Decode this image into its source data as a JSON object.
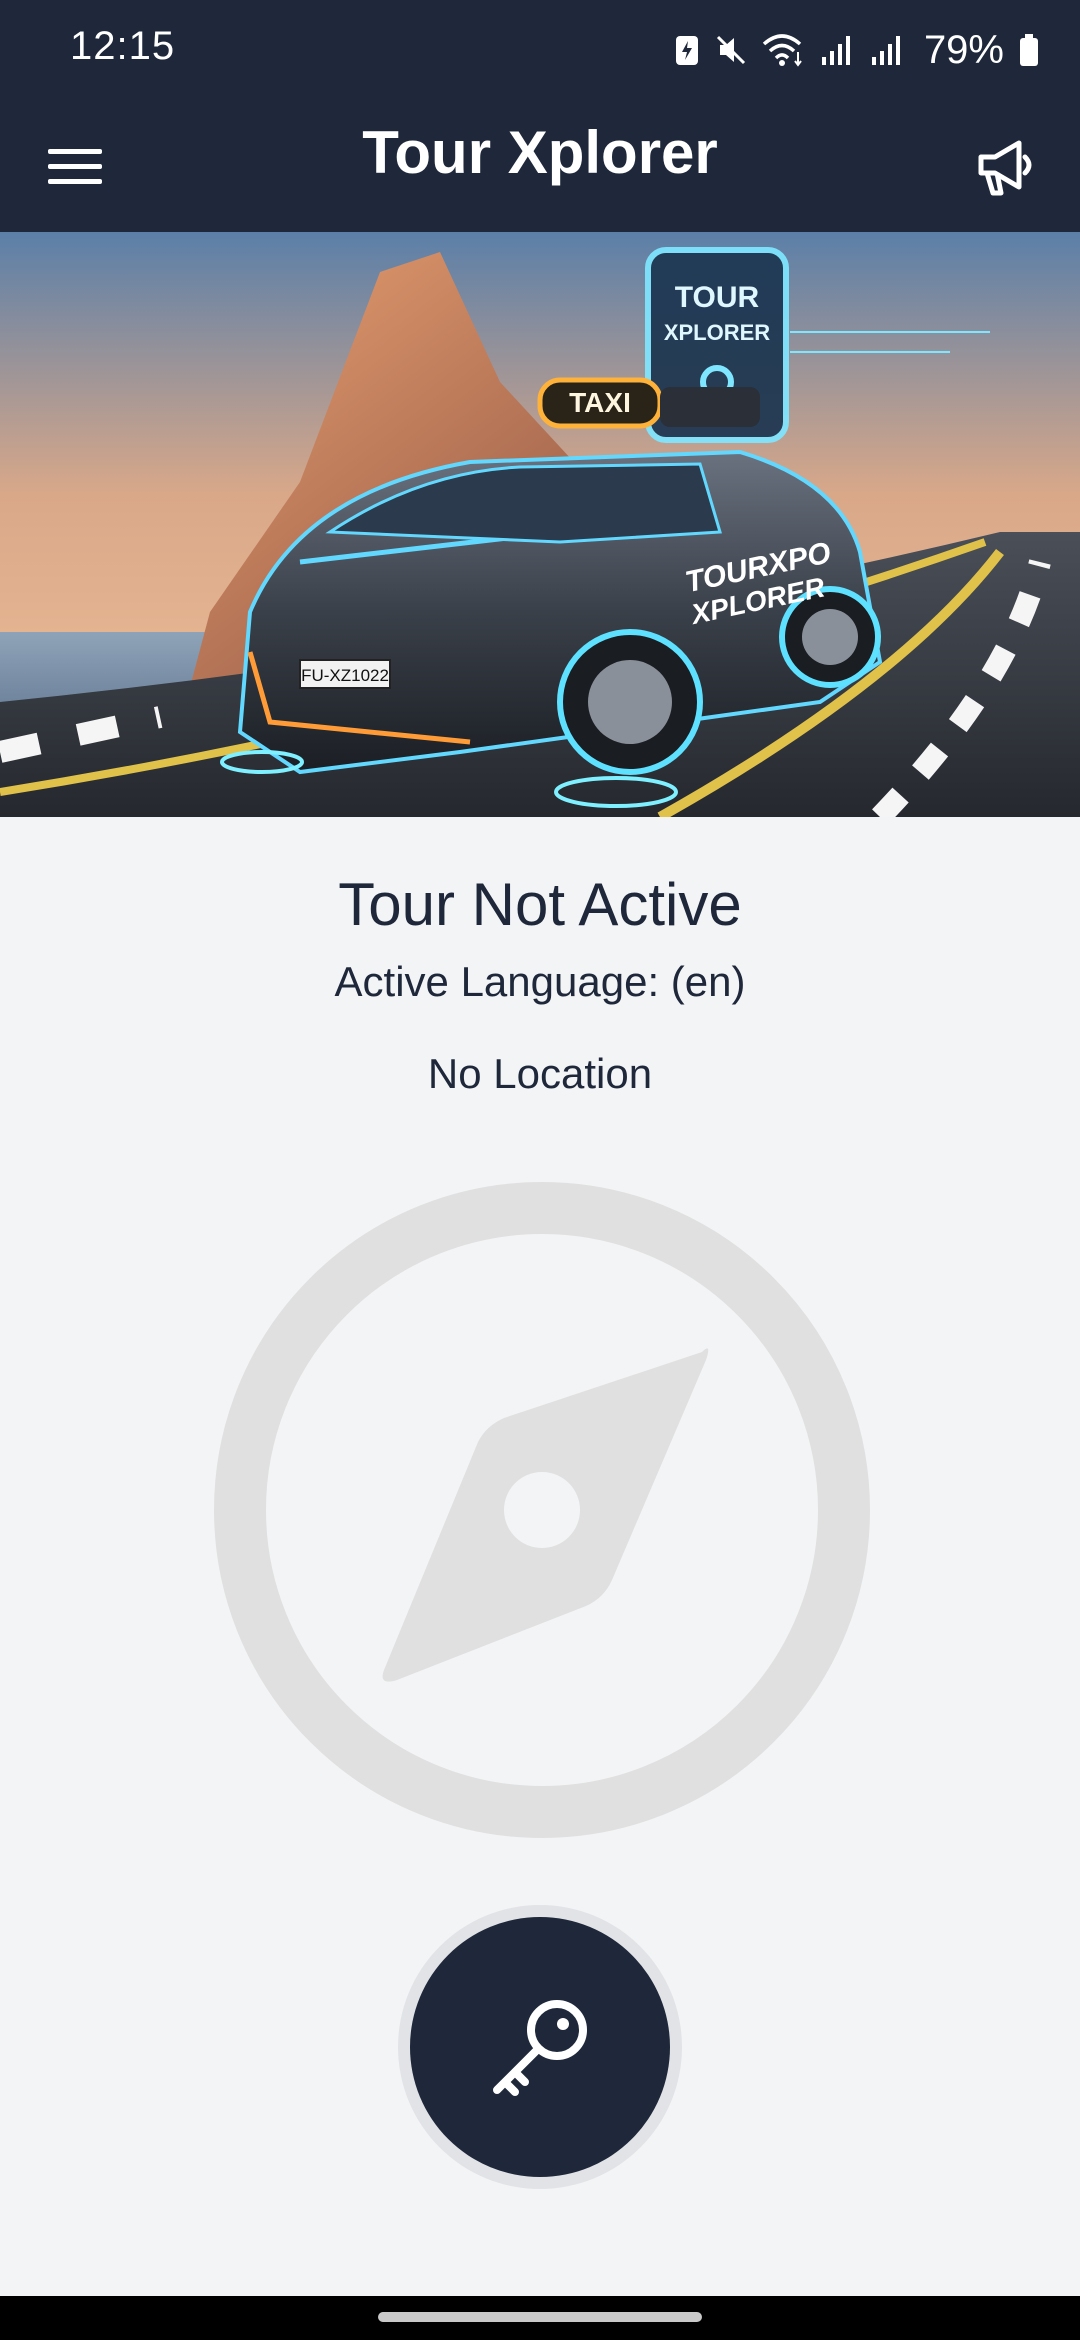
{
  "status_bar": {
    "time": "12:15",
    "battery_percent": "79%",
    "icons": [
      "battery-saver-icon",
      "mute-icon",
      "wifi-icon",
      "signal-icon",
      "signal-icon",
      "battery-icon"
    ]
  },
  "app_bar": {
    "title": "Tour Xplorer",
    "menu_icon": "hamburger-menu-icon",
    "action_icon": "megaphone-icon"
  },
  "banner": {
    "description_icon": "taxi-tour-banner-image",
    "taxi_sign": "TAXI",
    "sign_top": "TOUR",
    "sign_bottom": "XPLORER",
    "car_logo_line1": "TOURXPO",
    "car_logo_line2": "XPLORER",
    "plate": "FU-XZ1022"
  },
  "status": {
    "tour_status": "Tour Not Active",
    "active_language": "Active Language: (en)",
    "location": "No Location"
  },
  "compass_icon": "compass-icon",
  "key_button": {
    "icon": "key-icon"
  },
  "colors": {
    "header_bg": "#1e283a",
    "page_bg": "#f3f4f6",
    "text_primary": "#1e283a",
    "compass_gray": "#e0e0e0"
  }
}
